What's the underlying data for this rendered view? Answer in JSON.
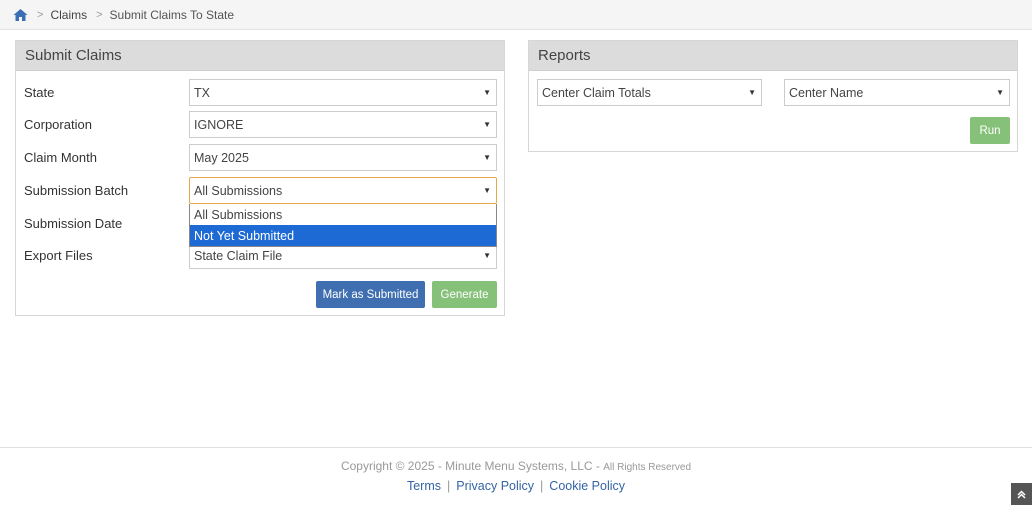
{
  "breadcrumb": {
    "home_icon": "home-icon",
    "items": [
      "Claims",
      "Submit Claims To State"
    ]
  },
  "submit_panel": {
    "title": "Submit Claims",
    "fields": {
      "state": {
        "label": "State",
        "value": "TX"
      },
      "corporation": {
        "label": "Corporation",
        "value": "IGNORE"
      },
      "claim_month": {
        "label": "Claim Month",
        "value": "May 2025"
      },
      "submission_batch": {
        "label": "Submission Batch",
        "value": "All Submissions"
      },
      "submission_date": {
        "label": "Submission Date"
      },
      "export_files": {
        "label": "Export Files",
        "value": "State Claim File"
      }
    },
    "batch_options": [
      "All Submissions",
      "Not Yet Submitted"
    ],
    "mark_button": "Mark as Submitted",
    "generate_button": "Generate"
  },
  "reports_panel": {
    "title": "Reports",
    "report_select": "Center Claim Totals",
    "sort_select": "Center Name",
    "run_button": "Run"
  },
  "footer": {
    "copyright": "Copyright © 2025 - Minute Menu Systems, LLC -",
    "rights": "All Rights Reserved",
    "links": [
      "Terms",
      "Privacy Policy",
      "Cookie Policy"
    ]
  },
  "colors": {
    "primary": "#3f6fb0",
    "success": "#86c17a",
    "highlight": "#1e6ad5",
    "link": "#3465a4"
  }
}
